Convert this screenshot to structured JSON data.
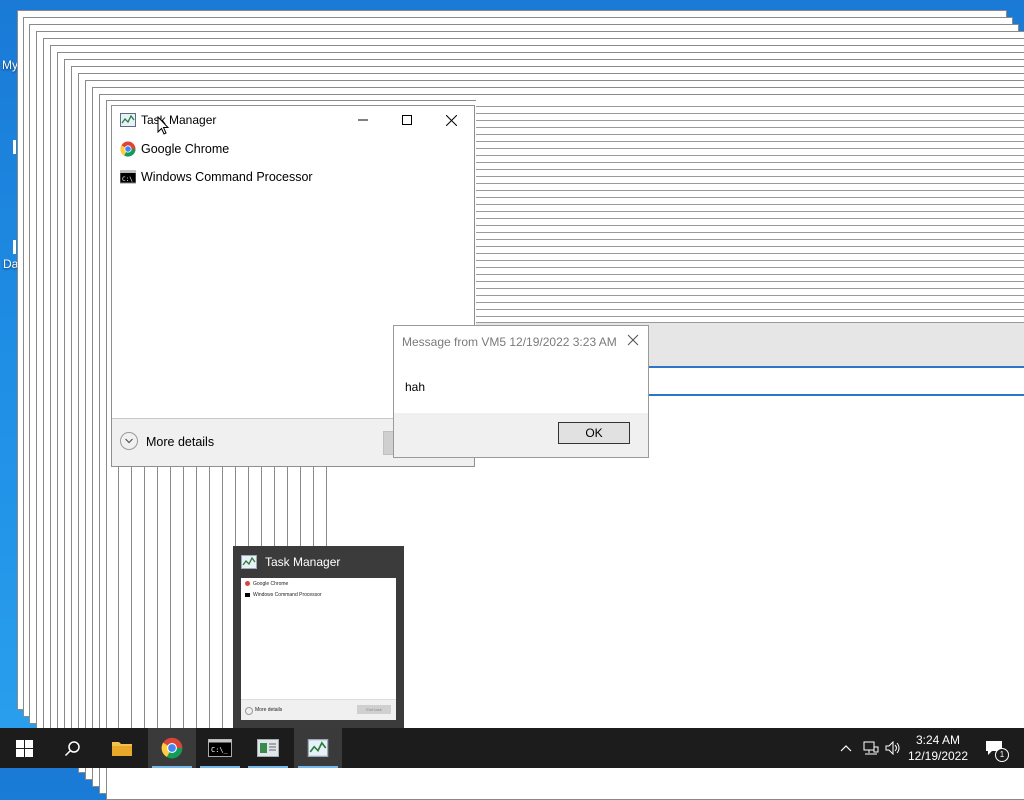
{
  "desktop": {
    "icon_labels": [
      "My",
      "Da"
    ]
  },
  "task_manager": {
    "title": "Task Manager",
    "apps": [
      {
        "label": "Google Chrome",
        "icon": "chrome-icon"
      },
      {
        "label": "Windows Command Processor",
        "icon": "cmd-icon"
      }
    ],
    "more_details": "More details"
  },
  "message_box": {
    "title": "Message from VM5 12/19/2022 3:23 AM",
    "body": "hah",
    "ok_label": "OK"
  },
  "thumbnail": {
    "title": "Task Manager",
    "rows": [
      "Google Chrome",
      "Windows Command Processor"
    ],
    "footer_left": "More details",
    "footer_right": "End task"
  },
  "taskbar": {
    "time": "3:24 AM",
    "date": "12/19/2022",
    "notification_count": "1",
    "accent": "#76b9ed"
  }
}
